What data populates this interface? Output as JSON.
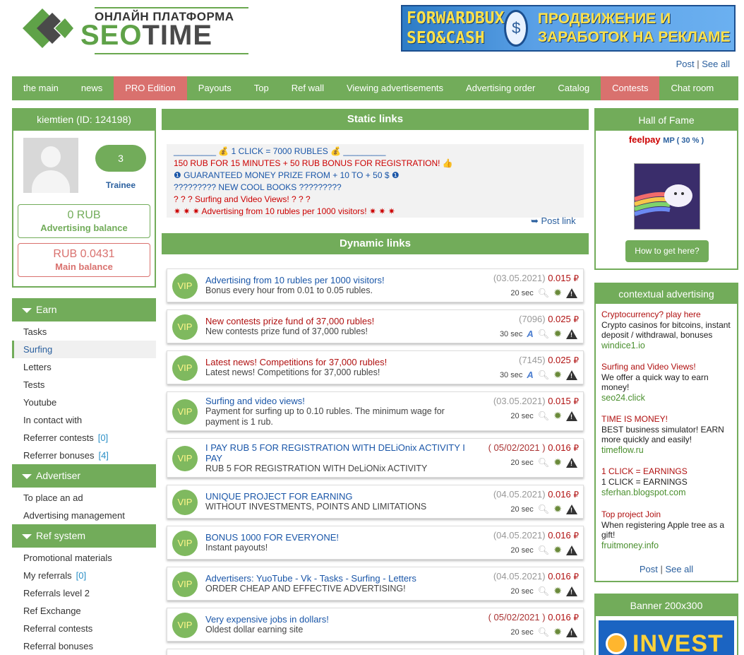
{
  "header": {
    "logo_top": "ОНЛАЙН ПЛАТФОРМА",
    "logo_seo": "SEO",
    "logo_time": "TIME",
    "banner_left": "FORWARDBUX SEO&CASH",
    "banner_right": "ПРОДВИЖЕНИЕ И ЗАРАБОТОК НА РЕКЛАМЕ",
    "post": "Post",
    "see_all": "See all"
  },
  "nav": [
    {
      "label": "the main"
    },
    {
      "label": "news"
    },
    {
      "label": "PRO Edition"
    },
    {
      "label": "Payouts"
    },
    {
      "label": "Top"
    },
    {
      "label": "Ref wall"
    },
    {
      "label": "Viewing advertisements"
    },
    {
      "label": "Advertising order"
    },
    {
      "label": "Catalog"
    },
    {
      "label": "Contests"
    },
    {
      "label": "Chat room"
    }
  ],
  "user": {
    "title": "kiemtien (ID: 124198)",
    "level": "3",
    "rank": "Trainee",
    "adv_balance": "0 RUB",
    "adv_balance_label": "Advertising balance",
    "main_balance": "RUB 0.0431",
    "main_balance_label": "Main balance"
  },
  "menu": {
    "earn": "Earn",
    "earn_items": [
      "Tasks",
      "Surfing",
      "Letters",
      "Tests",
      "Youtube",
      "In contact with",
      "Referrer contests",
      "Referrer bonuses"
    ],
    "earn_counts": {
      "ref_contests": "[0]",
      "ref_bonuses": "[4]"
    },
    "advertiser": "Advertiser",
    "adv_items": [
      "To place an ad",
      "Advertising management"
    ],
    "ref": "Ref system",
    "ref_items": [
      "Promotional materials",
      "My referrals",
      "Referrals level 2",
      "Ref Exchange",
      "Referral contests",
      "Referral bonuses"
    ],
    "ref_counts": {
      "my_referrals": "[0]"
    }
  },
  "static": {
    "title": "Static links",
    "lines": [
      "_________ 💰 1 CLICK = 7000 RUBLES 💰 _________",
      "150 RUB FOR 15 MINUTES + 50 RUB BONUS FOR REGISTRATION! 👍",
      "❶ GUARANTEED MONEY PRIZE FROM + 10 TO + 50 $ ❶",
      "????????? NEW COOL BOOKS ?????????",
      "? ? ? Surfing and Video Views! ? ? ?",
      "✷ ✷ ✷ Advertising from 10 rubles per 1000 visitors! ✷ ✷ ✷"
    ],
    "post_link": "➥ Post link"
  },
  "dynamic": {
    "title": "Dynamic links",
    "vip": "VIP",
    "currency": "₽",
    "items": [
      {
        "title": "Advertising from 10 rubles per 1000 visitors!",
        "desc": "Bonus every hour from 0.01 to 0.05 rubles.",
        "date": "(03.05.2021)",
        "price": "0.015",
        "time": "20 sec"
      },
      {
        "title": "New contests prize fund of 37,000 rubles!",
        "desc": "New contests prize fund of 37,000 rubles!",
        "date": "(7096)",
        "price": "0.025",
        "time": "30 sec"
      },
      {
        "title": "Latest news! Competitions for 37,000 rubles!",
        "desc": "Latest news! Competitions for 37,000 rubles!",
        "date": "(7145)",
        "price": "0.025",
        "time": "30 sec"
      },
      {
        "title": "Surfing and video views!",
        "desc": "Payment for surfing up to 0.10 rubles. The minimum wage for",
        "desc2": "payment is 1 rub.",
        "date": "(03.05.2021)",
        "price": "0.015",
        "time": "20 sec"
      },
      {
        "title": "I PAY RUB 5 FOR REGISTRATION WITH DELiOnix ACTIVITY I",
        "title2": "PAY",
        "desc": "RUB 5 FOR REGISTRATION WITH DeLiONix ACTIVITY",
        "date": "( 05/02/2021 )",
        "price": "0.016",
        "time": "20 sec"
      },
      {
        "title": "UNIQUE PROJECT FOR EARNING",
        "desc": "WITHOUT INVESTMENTS, POINTS AND LIMITATIONS",
        "date": "(04.05.2021)",
        "price": "0.016",
        "time": "20 sec"
      },
      {
        "title": "BONUS 1000 FOR EVERYONE!",
        "desc": "Instant payouts!",
        "date": "(04.05.2021)",
        "price": "0.016",
        "time": "20 sec"
      },
      {
        "title": "Advertisers: YuoTube - Vk - Tasks - Surfing - Letters",
        "desc": "ORDER CHEAP AND EFFECTIVE ADVERTISING!",
        "date": "(04.05.2021)",
        "price": "0.016",
        "time": "20 sec"
      },
      {
        "title": "Very expensive jobs in dollars!",
        "desc": "Oldest dollar earning site",
        "date": "( 05/02/2021 )",
        "price": "0.016",
        "time": "20 sec"
      }
    ]
  },
  "hall": {
    "title": "Hall of Fame",
    "user": "feelpay",
    "mp": "MP ( 30 % )",
    "button": "How to get here?"
  },
  "ctx": {
    "title": "contextual advertising",
    "items": [
      {
        "h": "Cryptocurrency? play here",
        "b": "Crypto casinos for bitcoins, instant deposit / withdrawal, bonuses",
        "u": "windice1.io"
      },
      {
        "h": "Surfing and Video Views!",
        "b": "We offer a quick way to earn money!",
        "u": "seo24.click"
      },
      {
        "h": "TIME IS MONEY!",
        "b": "BEST business simulator! EARN more quickly and easily!",
        "u": "timeflow.ru"
      },
      {
        "h": "1 CLICK = EARNINGS",
        "b": "1 CLICK = EARNINGS",
        "u": "sferhan.blogspot.com"
      },
      {
        "h": "Top project Join",
        "b": "When registering Apple tree as a gift!",
        "u": "fruitmoney.info"
      }
    ],
    "post": "Post",
    "see_all": "See all"
  },
  "banner": {
    "title": "Banner 200x300",
    "img_text": "INVEST"
  }
}
